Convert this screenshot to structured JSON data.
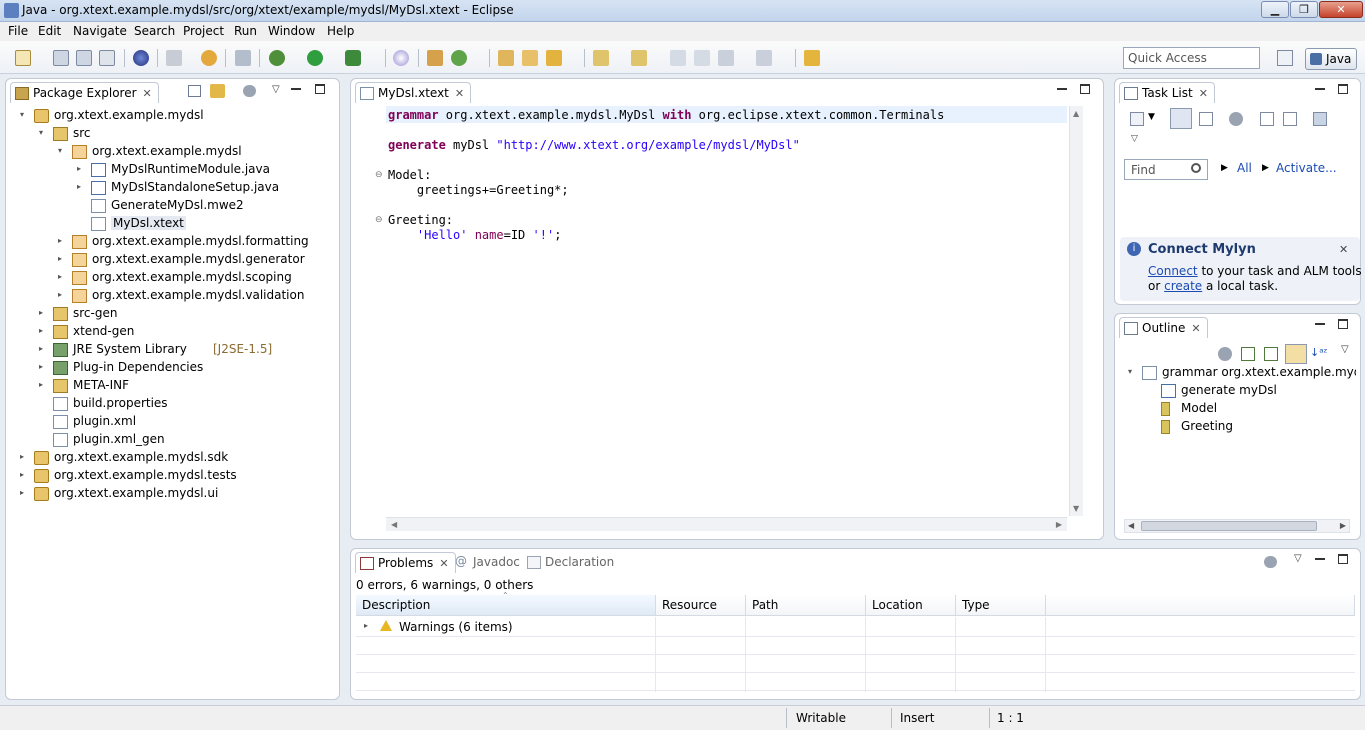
{
  "window": {
    "title": "Java - org.xtext.example.mydsl/src/org/xtext/example/mydsl/MyDsl.xtext - Eclipse",
    "minimize": "▁",
    "restore": "❐",
    "close": "✕"
  },
  "menu": [
    "File",
    "Edit",
    "Navigate",
    "Search",
    "Project",
    "Run",
    "Window",
    "Help"
  ],
  "quick_access": {
    "placeholder": "Quick Access"
  },
  "perspective": {
    "label": "Java"
  },
  "package_explorer": {
    "title": "Package Explorer",
    "tree": [
      {
        "label": "org.xtext.example.mydsl",
        "icon": "project-icon",
        "expand": "▾"
      },
      {
        "label": "src",
        "icon": "source-folder-icon",
        "expand": "▾"
      },
      {
        "label": "org.xtext.example.mydsl",
        "icon": "package-icon",
        "expand": "▾"
      },
      {
        "label": "MyDslRuntimeModule.java",
        "icon": "java-file-icon",
        "expand": "▸"
      },
      {
        "label": "MyDslStandaloneSetup.java",
        "icon": "java-file-icon",
        "expand": "▸"
      },
      {
        "label": "GenerateMyDsl.mwe2",
        "icon": "file-icon",
        "expand": ""
      },
      {
        "label": "MyDsl.xtext",
        "icon": "xtext-file-icon",
        "expand": ""
      },
      {
        "label": "org.xtext.example.mydsl.formatting",
        "icon": "package-icon",
        "expand": "▸"
      },
      {
        "label": "org.xtext.example.mydsl.generator",
        "icon": "package-icon",
        "expand": "▸"
      },
      {
        "label": "org.xtext.example.mydsl.scoping",
        "icon": "package-icon",
        "expand": "▸"
      },
      {
        "label": "org.xtext.example.mydsl.validation",
        "icon": "package-icon",
        "expand": "▸"
      },
      {
        "label": "src-gen",
        "icon": "source-folder-icon",
        "expand": "▸"
      },
      {
        "label": "xtend-gen",
        "icon": "source-folder-icon",
        "expand": "▸"
      },
      {
        "label": "JRE System Library",
        "suffix": "[J2SE-1.5]",
        "icon": "library-icon",
        "expand": "▸"
      },
      {
        "label": "Plug-in Dependencies",
        "icon": "library-icon",
        "expand": "▸"
      },
      {
        "label": "META-INF",
        "icon": "folder-icon",
        "expand": "▸"
      },
      {
        "label": "build.properties",
        "icon": "file-icon",
        "expand": ""
      },
      {
        "label": "plugin.xml",
        "icon": "xml-file-icon",
        "expand": ""
      },
      {
        "label": "plugin.xml_gen",
        "icon": "file-icon",
        "expand": ""
      },
      {
        "label": "org.xtext.example.mydsl.sdk",
        "icon": "project-icon",
        "expand": "▸"
      },
      {
        "label": "org.xtext.example.mydsl.tests",
        "icon": "project-icon",
        "expand": "▸"
      },
      {
        "label": "org.xtext.example.mydsl.ui",
        "icon": "project-icon",
        "expand": "▸"
      }
    ]
  },
  "editor": {
    "tab": "MyDsl.xtext",
    "lines": {
      "l1_kw": "grammar",
      "l1_a": " org.xtext.example.mydsl.MyDsl ",
      "l1_kw2": "with",
      "l1_b": " org.eclipse.xtext.common.Terminals",
      "l3_kw": "generate",
      "l3_a": " myDsl ",
      "l3_str": "\"http://www.xtext.org/example/mydsl/MyDsl\"",
      "l5": "Model:",
      "l6": "    greetings+=Greeting*;",
      "l8": "Greeting:",
      "l9_str": "'Hello'",
      "l9_a": " name",
      "l9_b": "=ID ",
      "l9_str2": "'!'",
      "l9_c": ";"
    },
    "fold_marks": [
      "⊖",
      "⊖"
    ]
  },
  "task_list": {
    "title": "Task List",
    "find_placeholder": "Find",
    "all": "All",
    "activate": "Activate...",
    "mylyn_title": "Connect Mylyn",
    "mylyn_connect": "Connect",
    "mylyn_text1": " to your task and ALM tools",
    "mylyn_or": "or ",
    "mylyn_create": "create",
    "mylyn_text2": " a local task."
  },
  "outline": {
    "title": "Outline",
    "items": [
      {
        "label": "grammar org.xtext.example.mydsl.M",
        "expand": "▾"
      },
      {
        "label": "generate myDsl",
        "expand": ""
      },
      {
        "label": "Model",
        "expand": ""
      },
      {
        "label": "Greeting",
        "expand": ""
      }
    ]
  },
  "bottom": {
    "tabs": [
      "Problems",
      "Javadoc",
      "Declaration"
    ],
    "summary": "0 errors, 6 warnings, 0 others",
    "columns": [
      "Description",
      "Resource",
      "Path",
      "Location",
      "Type"
    ],
    "row": {
      "expand": "▸",
      "label": "Warnings (6 items)"
    }
  },
  "status": {
    "writable": "Writable",
    "insert": "Insert",
    "position": "1 : 1"
  }
}
